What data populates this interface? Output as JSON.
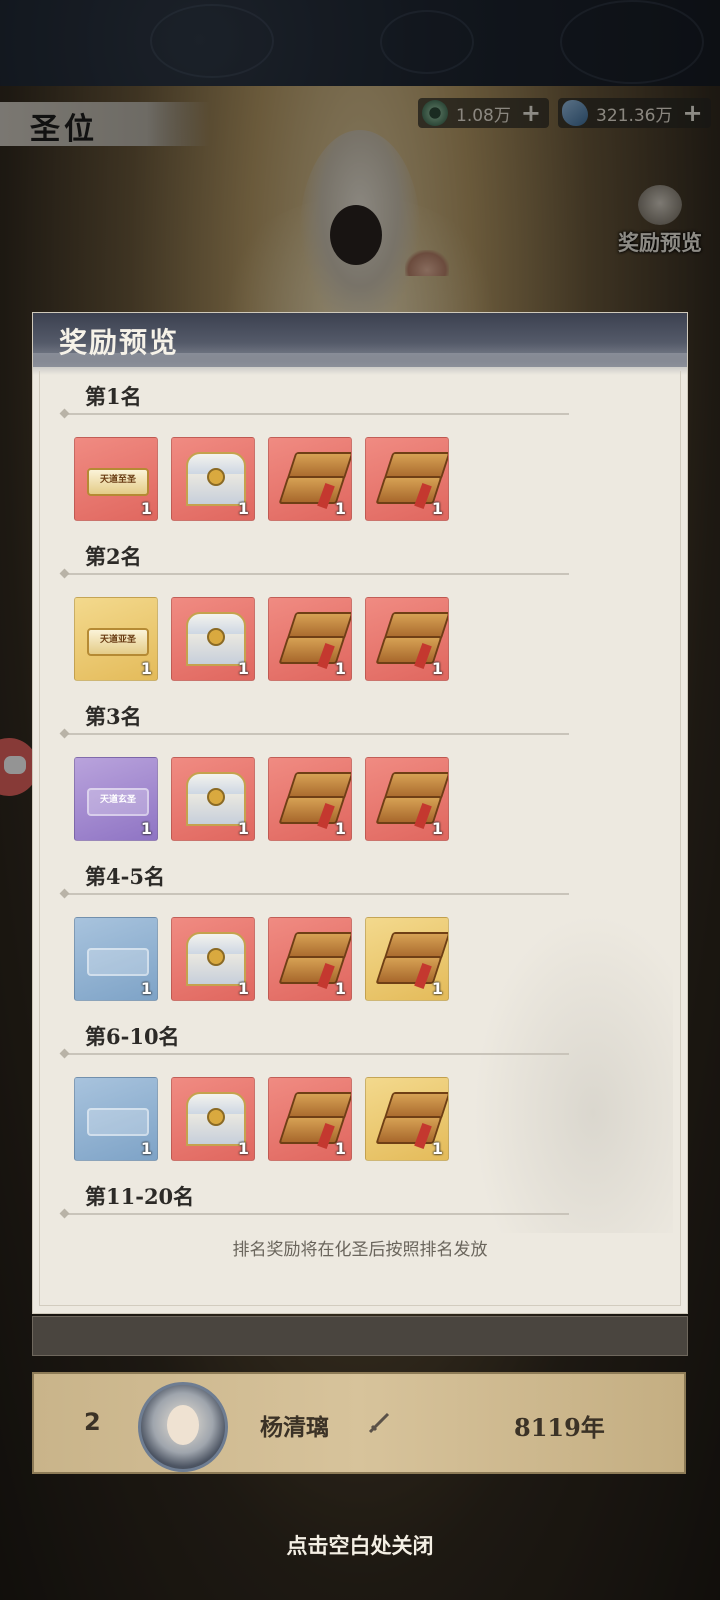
{
  "header": {
    "title": "圣位",
    "currency": [
      {
        "icon": "jade-ring-icon",
        "value": "1.08万"
      },
      {
        "icon": "spirit-stone-icon",
        "value": "321.36万"
      }
    ],
    "reward_preview_label": "奖励预览"
  },
  "modal": {
    "title": "奖励预览",
    "footer_note": "排名奖励将在化圣后按照排名发放",
    "ranks": [
      {
        "label": "第1名",
        "items": [
          {
            "kind": "token",
            "tone": "red",
            "art_text": "天道至圣",
            "qty": "1"
          },
          {
            "kind": "chest",
            "tone": "red",
            "qty": "1"
          },
          {
            "kind": "book",
            "tone": "red",
            "qty": "1"
          },
          {
            "kind": "book",
            "tone": "red",
            "qty": "1"
          }
        ]
      },
      {
        "label": "第2名",
        "items": [
          {
            "kind": "token",
            "tone": "gold",
            "art_text": "天道亚圣",
            "qty": "1"
          },
          {
            "kind": "chest",
            "tone": "red",
            "qty": "1"
          },
          {
            "kind": "book",
            "tone": "red",
            "qty": "1"
          },
          {
            "kind": "book",
            "tone": "red",
            "qty": "1"
          }
        ]
      },
      {
        "label": "第3名",
        "items": [
          {
            "kind": "token",
            "tone": "purple",
            "art_text": "天道玄圣",
            "qty": "1"
          },
          {
            "kind": "chest",
            "tone": "red",
            "qty": "1"
          },
          {
            "kind": "book",
            "tone": "red",
            "qty": "1"
          },
          {
            "kind": "book",
            "tone": "red",
            "qty": "1"
          }
        ]
      },
      {
        "label": "第4-5名",
        "items": [
          {
            "kind": "token",
            "tone": "blue",
            "art_text": "",
            "qty": "1"
          },
          {
            "kind": "chest",
            "tone": "red",
            "qty": "1"
          },
          {
            "kind": "book",
            "tone": "red",
            "qty": "1"
          },
          {
            "kind": "book",
            "tone": "gold",
            "qty": "1"
          }
        ]
      },
      {
        "label": "第6-10名",
        "items": [
          {
            "kind": "token",
            "tone": "blue",
            "art_text": "",
            "qty": "1"
          },
          {
            "kind": "chest",
            "tone": "red",
            "qty": "1"
          },
          {
            "kind": "book",
            "tone": "red",
            "qty": "1"
          },
          {
            "kind": "book",
            "tone": "gold",
            "qty": "1"
          }
        ]
      },
      {
        "label": "第11-20名",
        "items": []
      }
    ]
  },
  "my_rank": {
    "rank": "2",
    "name": "杨清璃",
    "score": "8119年"
  },
  "close_hint": "点击空白处关闭",
  "colors": {
    "red_item": "#e0675f",
    "gold_item": "#e4bb5a",
    "purple_item": "#8f74c4",
    "blue_item": "#7ea3c7",
    "modal_bg": "#ede9e0",
    "modal_header": "#3c4150"
  }
}
